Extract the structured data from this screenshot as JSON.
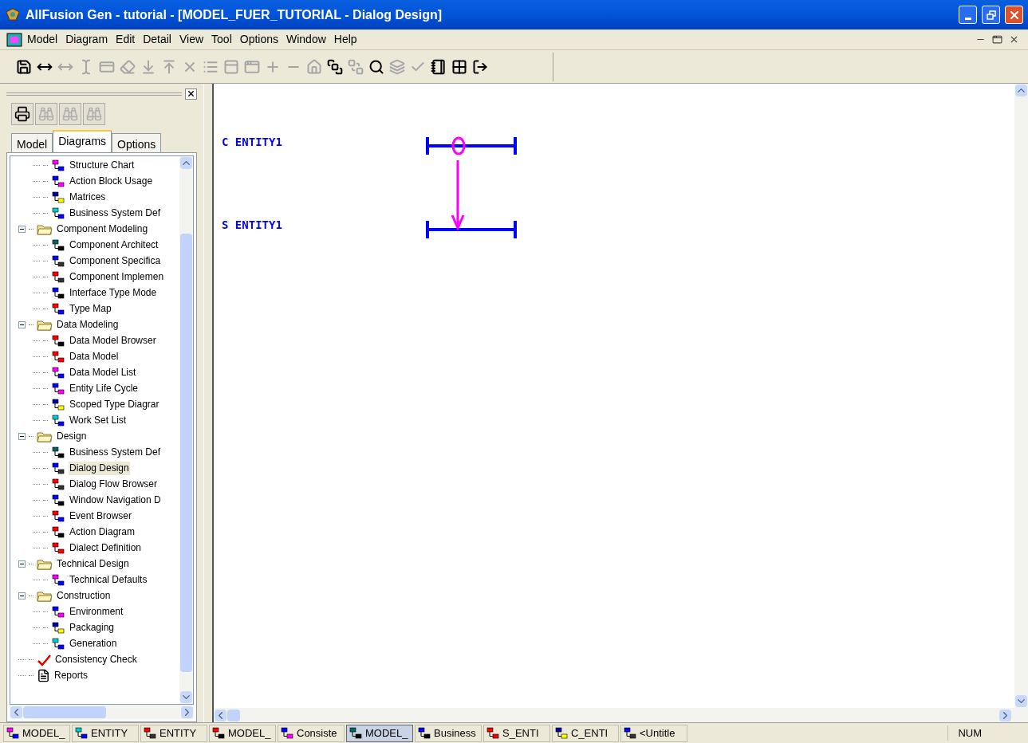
{
  "window": {
    "title": "AllFusion Gen - tutorial - [MODEL_FUER_TUTORIAL - Dialog Design]"
  },
  "menu": [
    "Model",
    "Diagram",
    "Edit",
    "Detail",
    "View",
    "Tool",
    "Options",
    "Window",
    "Help"
  ],
  "toolbar": [
    {
      "kind": "save",
      "disabled": false
    },
    {
      "kind": "link",
      "disabled": false
    },
    {
      "kind": "link",
      "disabled": true
    },
    {
      "kind": "ibeam",
      "disabled": true
    },
    {
      "kind": "box",
      "disabled": true
    },
    {
      "kind": "eraser",
      "disabled": true
    },
    {
      "kind": "import",
      "disabled": true
    },
    {
      "kind": "export",
      "disabled": true
    },
    {
      "kind": "delete",
      "disabled": true
    },
    {
      "kind": "list",
      "disabled": true
    },
    {
      "kind": "panel",
      "disabled": true
    },
    {
      "kind": "window",
      "disabled": true
    },
    {
      "kind": "plus",
      "disabled": true
    },
    {
      "kind": "minus",
      "disabled": true
    },
    {
      "kind": "home",
      "disabled": true
    },
    {
      "kind": "front",
      "disabled": false
    },
    {
      "kind": "back",
      "disabled": true
    },
    {
      "kind": "zoom",
      "disabled": false
    },
    {
      "kind": "stack",
      "disabled": true
    },
    {
      "kind": "check",
      "disabled": true
    },
    {
      "kind": "notebook",
      "disabled": false
    },
    {
      "kind": "grid",
      "disabled": false
    },
    {
      "kind": "exit",
      "disabled": false
    }
  ],
  "panel_tools": [
    {
      "kind": "print",
      "disabled": false
    },
    {
      "kind": "find",
      "disabled": true
    },
    {
      "kind": "find-next",
      "disabled": true
    },
    {
      "kind": "find-prev",
      "disabled": true
    }
  ],
  "tabs": [
    {
      "label": "Model",
      "selected": false
    },
    {
      "label": "Diagrams",
      "selected": true
    },
    {
      "label": "Options",
      "selected": false
    }
  ],
  "tree": [
    {
      "children": [
        {
          "kind": "diagram",
          "label": "Structure Chart",
          "selected": false
        },
        {
          "kind": "diagram",
          "label": "Action Block Usage",
          "selected": false
        },
        {
          "kind": "diagram",
          "label": "Matrices",
          "selected": false
        },
        {
          "kind": "diagram",
          "label": "Business System Def",
          "selected": false
        }
      ]
    },
    {
      "kind": "folder",
      "label": "Component Modeling",
      "expanded": true,
      "selected": false,
      "children": [
        {
          "kind": "diagram",
          "label": "Component Architect",
          "selected": false
        },
        {
          "kind": "diagram",
          "label": "Component Specifica",
          "selected": false
        },
        {
          "kind": "diagram",
          "label": "Component Implemen",
          "selected": false
        },
        {
          "kind": "diagram",
          "label": "Interface Type Mode",
          "selected": false
        },
        {
          "kind": "diagram",
          "label": "Type Map",
          "selected": false
        }
      ]
    },
    {
      "kind": "folder",
      "label": "Data Modeling",
      "expanded": true,
      "selected": false,
      "children": [
        {
          "kind": "diagram",
          "label": "Data Model Browser",
          "selected": false
        },
        {
          "kind": "diagram",
          "label": "Data Model",
          "selected": false
        },
        {
          "kind": "diagram",
          "label": "Data Model List",
          "selected": false
        },
        {
          "kind": "diagram",
          "label": "Entity Life Cycle",
          "selected": false
        },
        {
          "kind": "diagram",
          "label": "Scoped Type Diagrar",
          "selected": false
        },
        {
          "kind": "diagram",
          "label": "Work Set List",
          "selected": false
        }
      ]
    },
    {
      "kind": "folder",
      "label": "Design",
      "expanded": true,
      "selected": false,
      "children": [
        {
          "kind": "diagram",
          "label": "Business System Def",
          "selected": false
        },
        {
          "kind": "diagram",
          "label": "Dialog Design",
          "selected": true
        },
        {
          "kind": "diagram",
          "label": "Dialog Flow Browser",
          "selected": false
        },
        {
          "kind": "diagram",
          "label": "Window Navigation D",
          "selected": false
        },
        {
          "kind": "diagram",
          "label": "Event Browser",
          "selected": false
        },
        {
          "kind": "diagram",
          "label": "Action Diagram",
          "selected": false
        },
        {
          "kind": "diagram",
          "label": "Dialect Definition",
          "selected": false
        }
      ]
    },
    {
      "kind": "folder",
      "label": "Technical Design",
      "expanded": true,
      "selected": false,
      "children": [
        {
          "kind": "diagram",
          "label": "Technical Defaults",
          "selected": false
        }
      ]
    },
    {
      "kind": "folder",
      "label": "Construction",
      "expanded": true,
      "selected": false,
      "children": [
        {
          "kind": "diagram",
          "label": "Environment",
          "selected": false
        },
        {
          "kind": "diagram",
          "label": "Packaging",
          "selected": false
        },
        {
          "kind": "diagram",
          "label": "Generation",
          "selected": false
        }
      ]
    },
    {
      "kind": "check",
      "label": "Consistency Check",
      "selected": false
    },
    {
      "kind": "report",
      "label": "Reports",
      "selected": false
    }
  ],
  "canvas": {
    "labels": [
      "C ENTITY1",
      "S ENTITY1"
    ]
  },
  "taskbar": [
    {
      "label": "MODEL_",
      "selected": false
    },
    {
      "label": "ENTITY",
      "selected": false
    },
    {
      "label": "ENTITY",
      "selected": false
    },
    {
      "label": "MODEL_",
      "selected": false
    },
    {
      "label": "Consiste",
      "selected": false
    },
    {
      "label": "MODEL_",
      "selected": true
    },
    {
      "label": "Business",
      "selected": false
    },
    {
      "label": "S_ENTI",
      "selected": false
    },
    {
      "label": "C_ENTI",
      "selected": false
    },
    {
      "label": "<Untitle",
      "selected": false
    }
  ],
  "status": {
    "num": "NUM"
  }
}
